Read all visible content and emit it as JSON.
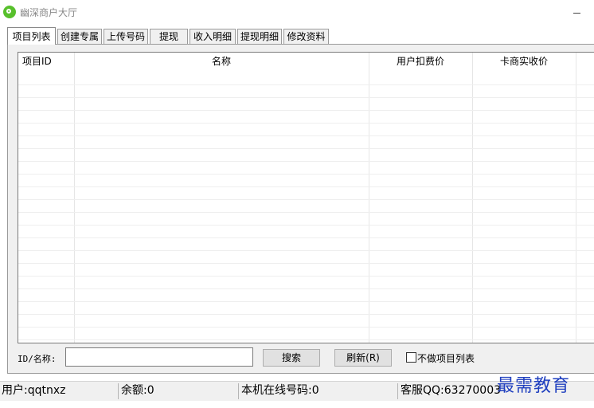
{
  "window": {
    "title": "幽深商户大厅"
  },
  "tabs": [
    {
      "label": "项目列表",
      "active": true
    },
    {
      "label": "创建专属",
      "active": false
    },
    {
      "label": "上传号码",
      "active": false
    },
    {
      "label": "提现",
      "active": false
    },
    {
      "label": "收入明细",
      "active": false
    },
    {
      "label": "提现明细",
      "active": false
    },
    {
      "label": "修改资料",
      "active": false
    }
  ],
  "table": {
    "columns": [
      "项目ID",
      "名称",
      "用户扣费价",
      "卡商实收价"
    ],
    "rows": []
  },
  "filter": {
    "label": "ID/名称:",
    "value": "",
    "search_label": "搜索",
    "refresh_label": "刷新(R)",
    "checkbox_label": "不做项目列表",
    "checkbox_checked": false
  },
  "status": {
    "user": "用户:qqtnxz",
    "balance": "余额:0",
    "online": "本机在线号码:0",
    "service": "客服QQ:63270003"
  },
  "watermark": "最需教育"
}
